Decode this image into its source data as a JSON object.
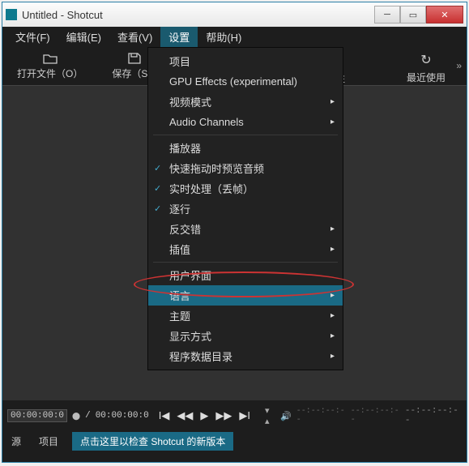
{
  "titlebar": {
    "title": "Untitled - Shotcut"
  },
  "menubar": {
    "items": [
      {
        "label": "文件(F)"
      },
      {
        "label": "编辑(E)"
      },
      {
        "label": "查看(V)"
      },
      {
        "label": "设置"
      },
      {
        "label": "帮助(H)"
      }
    ]
  },
  "toolbar": {
    "open": "打开文件（O）",
    "save": "保存（S）",
    "props_tail": "性",
    "recent": "最近使用",
    "recent_icon": "↻",
    "more": "»"
  },
  "dropdown": {
    "project": "项目",
    "gpu": "GPU Effects (experimental)",
    "video_mode": "视频模式",
    "audio_channels": "Audio Channels",
    "player": "播放器",
    "scrub_audio": "快速拖动时预览音频",
    "realtime": "实时处理（丢帧）",
    "progressive": "逐行",
    "deinterlace": "反交错",
    "interpolation": "插值",
    "ui": "用户界面",
    "language": "语言",
    "theme": "主题",
    "display": "显示方式",
    "appdata": "程序数据目录"
  },
  "timeline": {
    "t1": "00:00:00:0",
    "t2": "00:00:00:0",
    "sep": "/",
    "dur": "--:--:--:--",
    "dash": "--:--:--:--",
    "end": "--:--:--:--",
    "handle": "⬤"
  },
  "status": {
    "source": "源",
    "project": "项目",
    "update": "点击这里以检查 Shotcut 的新版本"
  }
}
